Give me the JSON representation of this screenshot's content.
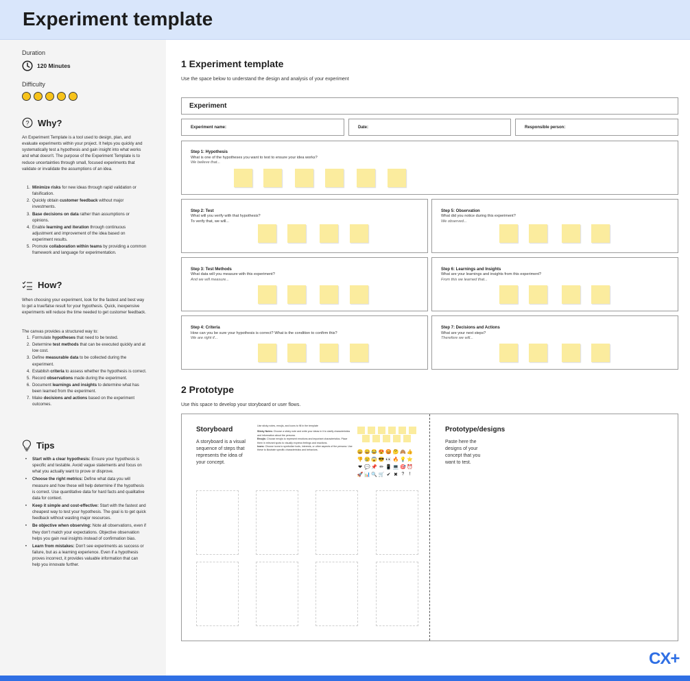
{
  "header": {
    "title": "Experiment template"
  },
  "sidebar": {
    "duration_label": "Duration",
    "duration_value": "120 Minutes",
    "difficulty_label": "Difficulty",
    "difficulty_level": 5,
    "why": {
      "title": "Why?",
      "intro": "An Experiment Template is a tool used to design, plan, and evaluate experiments within your project. It helps you quickly and systematically test a hypothesis and gain insight into what works and what doesn't. The purpose of the Experiment Template is to reduce uncertainties through small, focused experiments that validate or invalidate the assumptions of an idea.",
      "items": [
        {
          "num": "1.",
          "bold": "Minimize risks",
          "rest": " for new ideas through rapid validation or falsification."
        },
        {
          "num": "2.",
          "pre": "Quickly obtain ",
          "bold": "customer feedback",
          "rest": " without major investments."
        },
        {
          "num": "3.",
          "bold": "Base decisions on data",
          "rest": " rather than assumptions or opinions."
        },
        {
          "num": "4.",
          "pre": "Enable ",
          "bold": "learning and iteration",
          "rest": " through continuous adjustment and improvement of the idea based on experiment results."
        },
        {
          "num": "5.",
          "pre": "Promote ",
          "bold": "collaboration within teams",
          "rest": " by providing a common framework and language for experimentation."
        }
      ]
    },
    "how": {
      "title": "How?",
      "intro": "When choosing your experiment, look for the fastest and best way to get a true/false result for your hypothesis. Quick, inexpensive experiments will reduce the time needed to get customer feedback.",
      "intro2": "The canvas provides a structured way to:",
      "items": [
        {
          "num": "1.",
          "pre": "Formulate ",
          "bold": "hypotheses",
          "rest": " that need to be tested."
        },
        {
          "num": "2.",
          "pre": "Determine ",
          "bold": "test methods",
          "rest": " that can be executed quickly and at low cost."
        },
        {
          "num": "3.",
          "pre": "Define ",
          "bold": "measurable data",
          "rest": " to be collected during the experiment."
        },
        {
          "num": "4.",
          "pre": "Establish ",
          "bold": "criteria",
          "rest": " to assess whether the hypothesis is correct."
        },
        {
          "num": "5.",
          "pre": "Record ",
          "bold": "observations",
          "rest": " made during the experiment."
        },
        {
          "num": "6.",
          "pre": "Document ",
          "bold": "learnings and insights",
          "rest": " to determine what has been learned from the experiment."
        },
        {
          "num": "7.",
          "pre": "Make ",
          "bold": "decisions and actions",
          "rest": " based on the experiment outcomes."
        }
      ]
    },
    "tips": {
      "title": "Tips",
      "items": [
        {
          "bold": "Start with a clear hypothesis:",
          "rest": " Ensure your hypothesis is specific and testable. Avoid vague statements and focus on what you actually want to prove or disprove."
        },
        {
          "bold": "Choose the right metrics:",
          "rest": " Define what data you will measure and how these will help determine if the hypothesis is correct. Use quantitative data for hard facts and qualitative data for context."
        },
        {
          "bold": "Keep it simple and cost-effective:",
          "rest": " Start with the fastest and cheapest way to test your hypothesis. The goal is to get quick feedback without wasting major resources."
        },
        {
          "bold": "Be objective when observing:",
          "rest": " Note all observations, even if they don't match your expectations. Objective observation helps you gain real insights instead of confirmation bias."
        },
        {
          "bold": "Learn from mistakes:",
          "rest": " Don't see experiments as success or failure, but as a learning experience. Even if a hypothesis proves incorrect, it provides valuable information that can help you innovate further."
        }
      ]
    }
  },
  "section1": {
    "title": "1 Experiment template",
    "subtitle": "Use the space below to understand the design and analysis of your experiment",
    "box_title": "Experiment",
    "fields": [
      "Experiment name:",
      "Date:",
      "Responsible person:"
    ],
    "steps": [
      {
        "title": "Step 1: Hypothesis",
        "question": "What is one of the hypotheses you want to test to ensure your idea works?",
        "prompt": "We believe that..."
      },
      {
        "title": "Step 2: Test",
        "question": "What will you verify with that hypothesis?",
        "prompt": "To verify that, we will..."
      },
      {
        "title": "Step 5: Observation",
        "question": "What did you notice during this experiment?",
        "prompt": "We observed..."
      },
      {
        "title": "Step 3: Test Methods",
        "question": "What data will you measure with this experiment?",
        "prompt": "And we will measure..."
      },
      {
        "title": "Step 6: Learnings and Insights",
        "question": "What are your learnings and insights from this experiment?",
        "prompt": "From this we learned that..."
      },
      {
        "title": "Step 4: Criteria",
        "question": "How can you be sure your hypothesis is correct? What is the condition to confirm this?",
        "prompt": "We are right if..."
      },
      {
        "title": "Step 7: Decisions and Actions",
        "question": "What are your next steps?",
        "prompt": "Therefore we will..."
      }
    ]
  },
  "section2": {
    "title": "2 Prototype",
    "subtitle": "Use this space to develop your storyboard or user flows.",
    "storyboard_title": "Storyboard",
    "storyboard_desc": "A storyboard is a visual sequence of steps that represents the idea of your concept.",
    "instructions": {
      "intro": "Use sticky notes, emojis, and icons to fill in the template",
      "sticky_label": "Sticky Notes:",
      "sticky_text": " Choose a sticky note and write your ideas in it to clarify characteristics and information about the persona.",
      "emojis_label": "Emojis:",
      "emojis_text": " Choose emojis to represent emotions and important characteristics. Place them in relevant spots to visually express feelings and reactions.",
      "icons_label": "Icons:",
      "icons_text": " Choose icons to symbolize tools, interests, or other aspects of the persona. Use these to illustrate specific characteristics and behaviors."
    },
    "emojis": [
      "😀",
      "😄",
      "😂",
      "😍",
      "😡",
      "🤔",
      "🙈",
      "👍",
      "👎",
      "😢",
      "😱",
      "😎",
      "👀",
      "🔥",
      "💡",
      "⭐",
      "❤",
      "💬",
      "📌",
      "✏",
      "📱",
      "💻",
      "🎯",
      "⏰",
      "🚀",
      "📊",
      "🔍",
      "🛒",
      "✔",
      "✖",
      "?",
      "!"
    ],
    "prototype_title": "Prototype/designs",
    "prototype_desc": "Paste here the designs of your concept that you want to test."
  },
  "footer": {
    "logo": "CX+"
  },
  "colors": {
    "header_bg": "#d9e6fb",
    "accent_blue": "#2f6fe4",
    "sticky_yellow": "#fbec9e",
    "star_yellow": "#f7c31b"
  }
}
